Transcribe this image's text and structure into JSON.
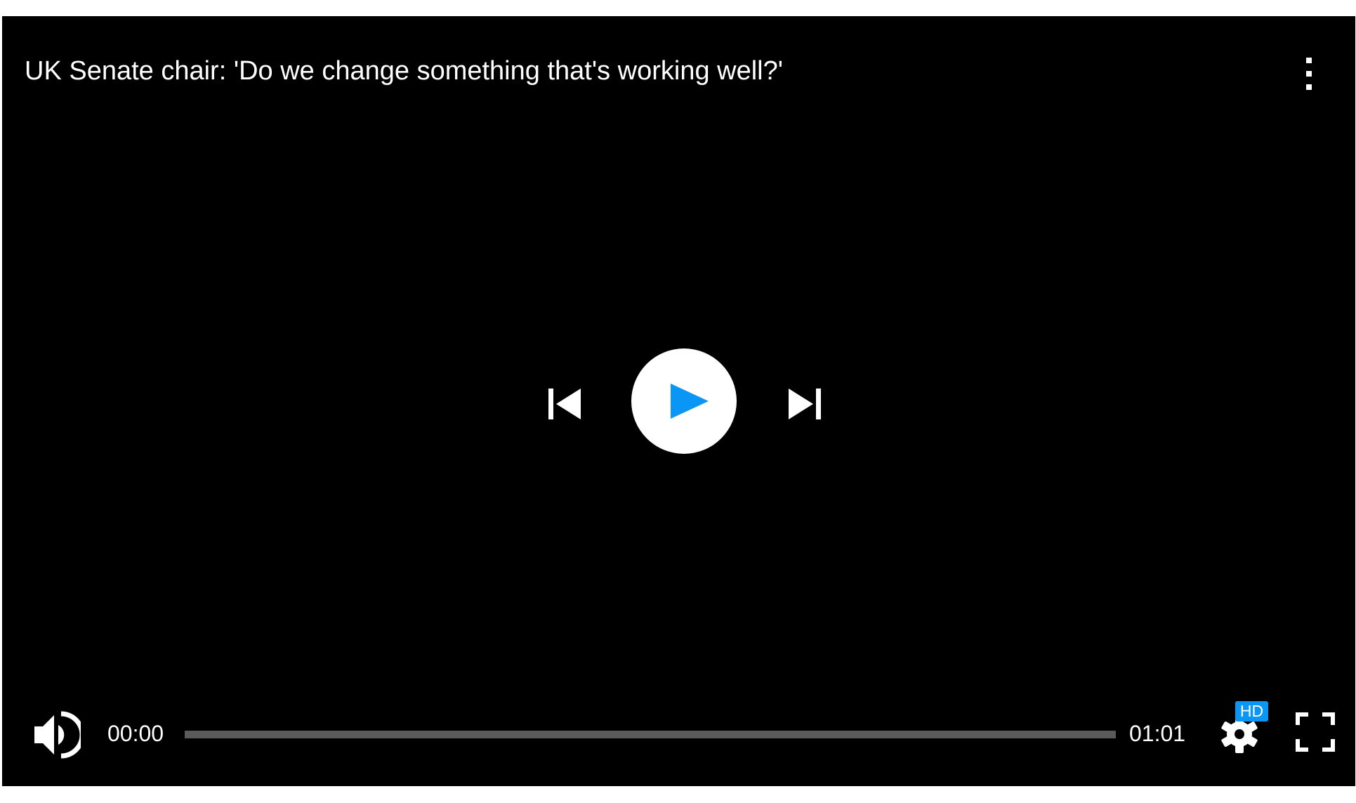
{
  "video": {
    "title": "UK Senate chair: 'Do we change something that's working well?'",
    "current_time": "00:00",
    "duration": "01:01",
    "progress_fraction": 0,
    "quality_badge": "HD"
  },
  "icons": {
    "menu": "more-vertical-icon",
    "previous": "skip-previous-icon",
    "play": "play-icon",
    "next": "skip-next-icon",
    "volume": "volume-icon",
    "settings": "gear-icon",
    "fullscreen": "fullscreen-icon"
  },
  "colors": {
    "background": "#000000",
    "accent": "#0a96f5",
    "track": "#5a5a5a",
    "foreground": "#ffffff"
  }
}
